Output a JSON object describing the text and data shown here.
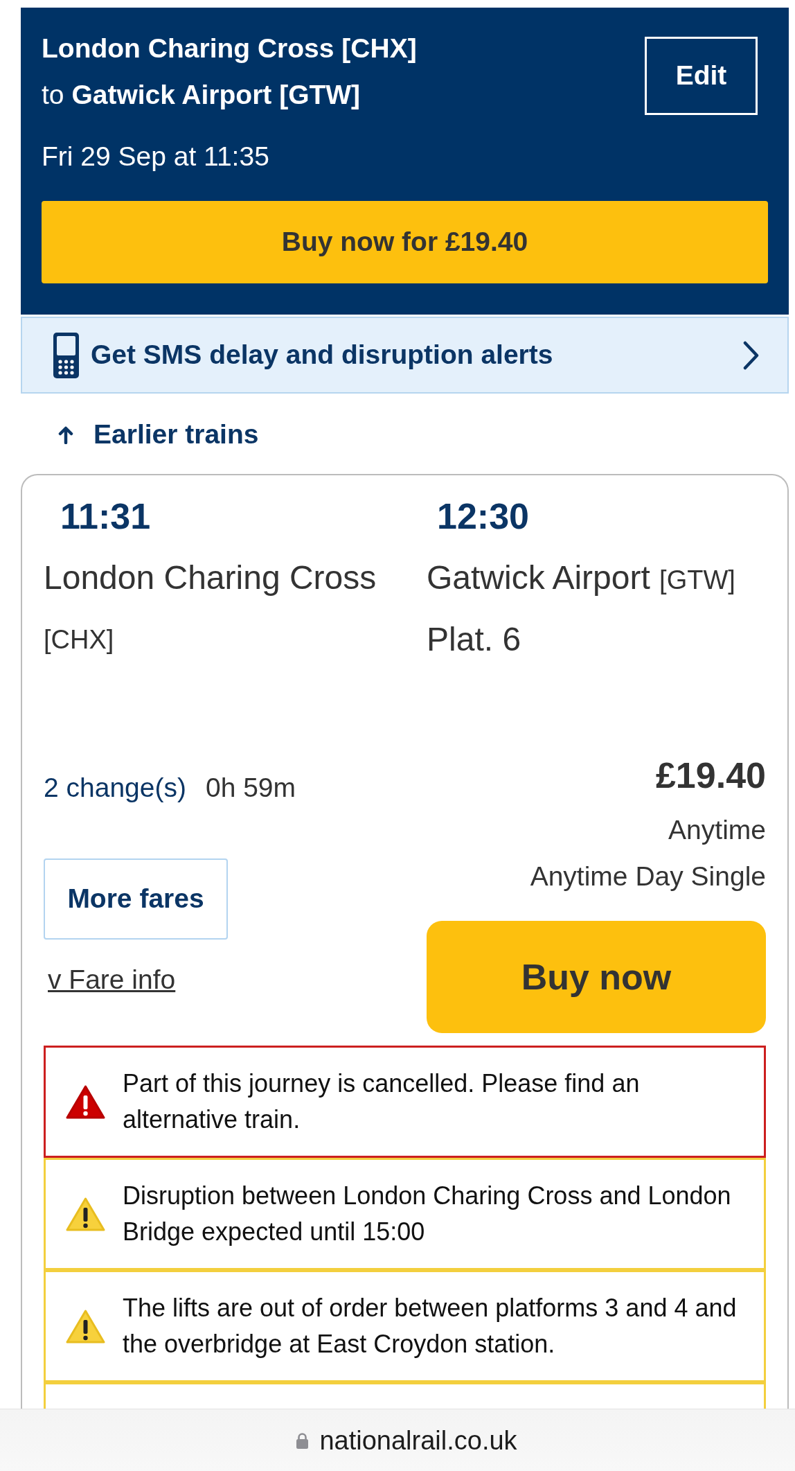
{
  "journey_header": {
    "origin": "London Charing Cross [CHX]",
    "destination": "to **Gatwick Airport [GTW]**",
    "edit_button": "Edit",
    "date_time": "Fri 29 Sep at 11:35",
    "buy_button": "Buy now for £19.40"
  },
  "sms_banner": {
    "label": "Get SMS delay and disruption alerts"
  },
  "earlier_trains": {
    "label": "Earlier trains"
  },
  "journey_card": {
    "departure": {
      "time": "11:31",
      "station": "London Charing Cross",
      "code": "[CHX]"
    },
    "arrival": {
      "time": "12:30",
      "station": "Gatwick Airport",
      "code": "[GTW]",
      "platform": "Plat. 6"
    },
    "changes": "2 change(s)",
    "duration": "0h 59m",
    "price": "£19.40",
    "fare_type": "Anytime",
    "ticket": "Anytime Day Single",
    "more_fares_button": "More fares",
    "fare_info_link": "v Fare info",
    "buy_button": "Buy now",
    "alerts": [
      {
        "kind": "cancellation",
        "message": "Part of this journey is cancelled. Please find an alternative train."
      },
      {
        "kind": "warning",
        "message": "Disruption between London Charing Cross and London Bridge expected until 15:00"
      },
      {
        "kind": "warning",
        "message": "The lifts are out of order between platforms 3 and 4 and the overbridge at East Croydon station."
      },
      {
        "kind": "warning"
      }
    ]
  },
  "browser_bar": {
    "address": "nationalrail.co.uk"
  }
}
